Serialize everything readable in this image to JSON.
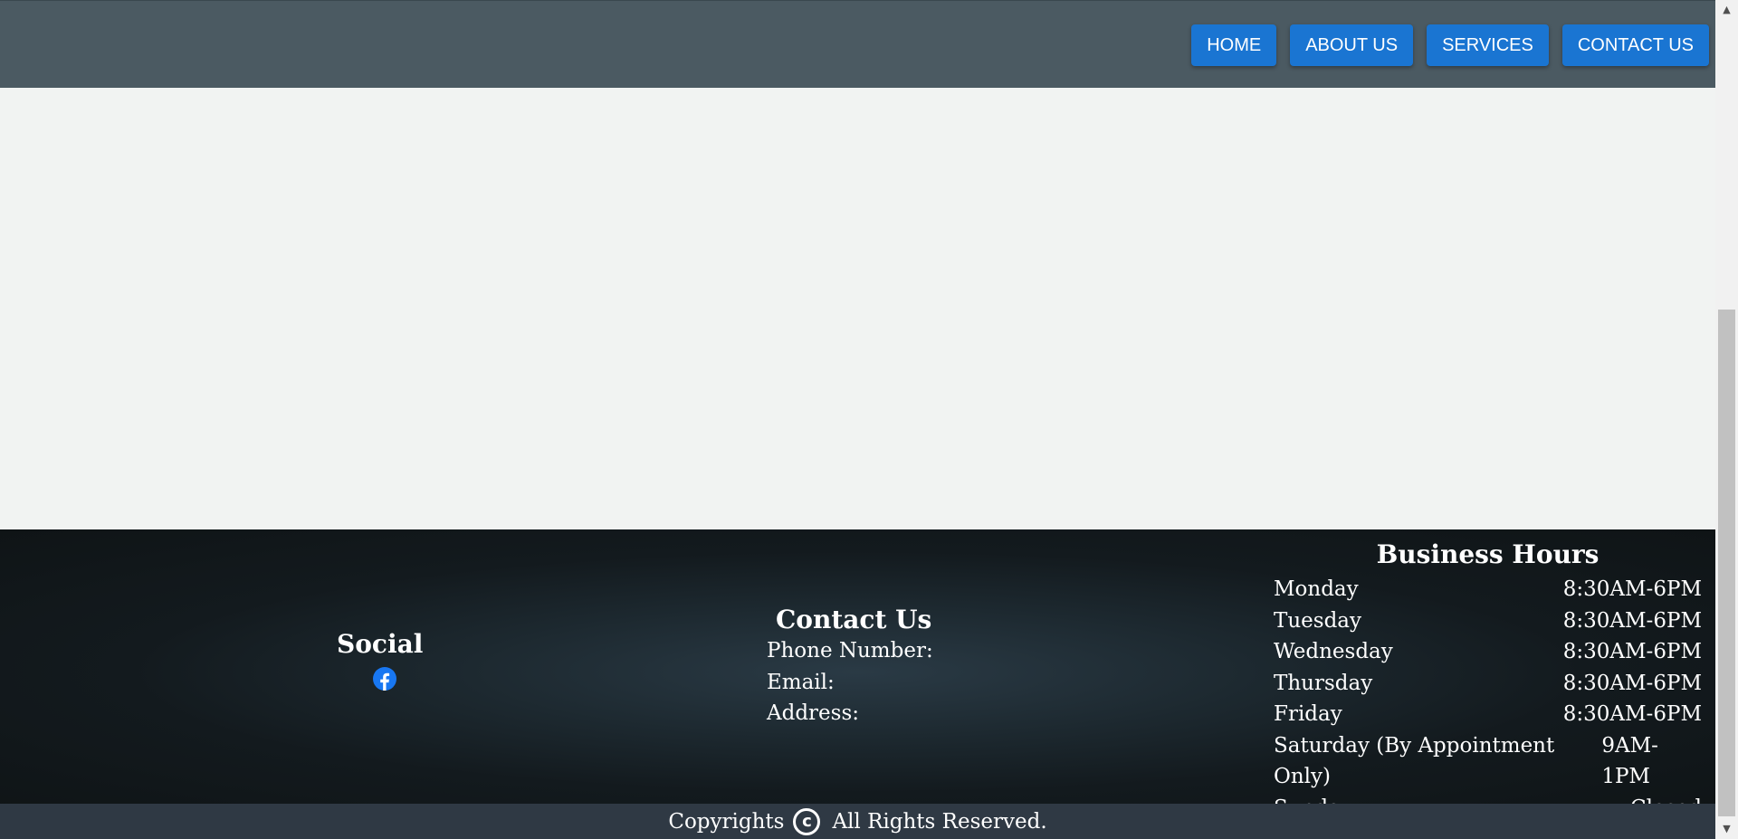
{
  "nav": {
    "items": [
      {
        "label": "HOME"
      },
      {
        "label": "ABOUT US"
      },
      {
        "label": "SERVICES"
      },
      {
        "label": "CONTACT US"
      }
    ]
  },
  "footer": {
    "social": {
      "title": "Social",
      "icon": "facebook-icon"
    },
    "contact": {
      "title": "Contact Us",
      "phone_label": "Phone Number:",
      "email_label": "Email:",
      "address_label": "Address:"
    },
    "hours": {
      "title": "Business Hours",
      "rows": [
        {
          "day": "Monday",
          "time": "8:30AM-6PM"
        },
        {
          "day": "Tuesday",
          "time": "8:30AM-6PM"
        },
        {
          "day": "Wednesday",
          "time": "8:30AM-6PM"
        },
        {
          "day": "Thursday",
          "time": "8:30AM-6PM"
        },
        {
          "day": "Friday",
          "time": "8:30AM-6PM"
        },
        {
          "day": "Saturday (By Appointment Only)",
          "time": "9AM-1PM"
        },
        {
          "day": "Sunday",
          "time": "Closed"
        }
      ]
    },
    "copyright": {
      "prefix": "Copyrights",
      "symbol": "c",
      "suffix": "All Rights Reserved."
    }
  },
  "colors": {
    "header_bg": "#4b5a62",
    "nav_button": "#1a75d2",
    "content_bg": "#f1f3f2",
    "footer_bg": "#131a1e",
    "copyright_bg": "#2f3944",
    "facebook_blue": "#1877f2"
  }
}
